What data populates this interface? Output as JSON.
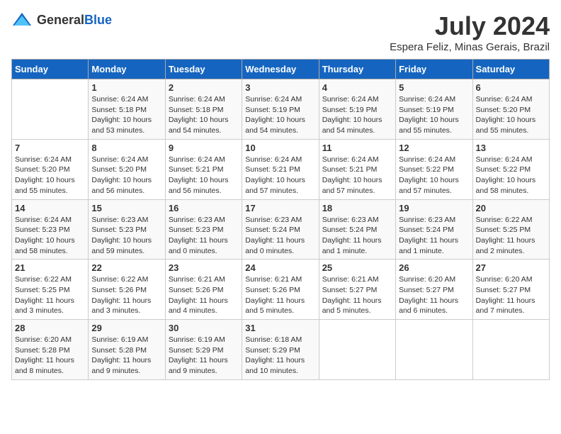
{
  "logo": {
    "general": "General",
    "blue": "Blue"
  },
  "title": "July 2024",
  "subtitle": "Espera Feliz, Minas Gerais, Brazil",
  "calendar": {
    "headers": [
      "Sunday",
      "Monday",
      "Tuesday",
      "Wednesday",
      "Thursday",
      "Friday",
      "Saturday"
    ],
    "weeks": [
      [
        {
          "day": "",
          "info": ""
        },
        {
          "day": "1",
          "info": "Sunrise: 6:24 AM\nSunset: 5:18 PM\nDaylight: 10 hours\nand 53 minutes."
        },
        {
          "day": "2",
          "info": "Sunrise: 6:24 AM\nSunset: 5:18 PM\nDaylight: 10 hours\nand 54 minutes."
        },
        {
          "day": "3",
          "info": "Sunrise: 6:24 AM\nSunset: 5:19 PM\nDaylight: 10 hours\nand 54 minutes."
        },
        {
          "day": "4",
          "info": "Sunrise: 6:24 AM\nSunset: 5:19 PM\nDaylight: 10 hours\nand 54 minutes."
        },
        {
          "day": "5",
          "info": "Sunrise: 6:24 AM\nSunset: 5:19 PM\nDaylight: 10 hours\nand 55 minutes."
        },
        {
          "day": "6",
          "info": "Sunrise: 6:24 AM\nSunset: 5:20 PM\nDaylight: 10 hours\nand 55 minutes."
        }
      ],
      [
        {
          "day": "7",
          "info": "Sunrise: 6:24 AM\nSunset: 5:20 PM\nDaylight: 10 hours\nand 55 minutes."
        },
        {
          "day": "8",
          "info": "Sunrise: 6:24 AM\nSunset: 5:20 PM\nDaylight: 10 hours\nand 56 minutes."
        },
        {
          "day": "9",
          "info": "Sunrise: 6:24 AM\nSunset: 5:21 PM\nDaylight: 10 hours\nand 56 minutes."
        },
        {
          "day": "10",
          "info": "Sunrise: 6:24 AM\nSunset: 5:21 PM\nDaylight: 10 hours\nand 57 minutes."
        },
        {
          "day": "11",
          "info": "Sunrise: 6:24 AM\nSunset: 5:21 PM\nDaylight: 10 hours\nand 57 minutes."
        },
        {
          "day": "12",
          "info": "Sunrise: 6:24 AM\nSunset: 5:22 PM\nDaylight: 10 hours\nand 57 minutes."
        },
        {
          "day": "13",
          "info": "Sunrise: 6:24 AM\nSunset: 5:22 PM\nDaylight: 10 hours\nand 58 minutes."
        }
      ],
      [
        {
          "day": "14",
          "info": "Sunrise: 6:24 AM\nSunset: 5:23 PM\nDaylight: 10 hours\nand 58 minutes."
        },
        {
          "day": "15",
          "info": "Sunrise: 6:23 AM\nSunset: 5:23 PM\nDaylight: 10 hours\nand 59 minutes."
        },
        {
          "day": "16",
          "info": "Sunrise: 6:23 AM\nSunset: 5:23 PM\nDaylight: 11 hours\nand 0 minutes."
        },
        {
          "day": "17",
          "info": "Sunrise: 6:23 AM\nSunset: 5:24 PM\nDaylight: 11 hours\nand 0 minutes."
        },
        {
          "day": "18",
          "info": "Sunrise: 6:23 AM\nSunset: 5:24 PM\nDaylight: 11 hours\nand 1 minute."
        },
        {
          "day": "19",
          "info": "Sunrise: 6:23 AM\nSunset: 5:24 PM\nDaylight: 11 hours\nand 1 minute."
        },
        {
          "day": "20",
          "info": "Sunrise: 6:22 AM\nSunset: 5:25 PM\nDaylight: 11 hours\nand 2 minutes."
        }
      ],
      [
        {
          "day": "21",
          "info": "Sunrise: 6:22 AM\nSunset: 5:25 PM\nDaylight: 11 hours\nand 3 minutes."
        },
        {
          "day": "22",
          "info": "Sunrise: 6:22 AM\nSunset: 5:26 PM\nDaylight: 11 hours\nand 3 minutes."
        },
        {
          "day": "23",
          "info": "Sunrise: 6:21 AM\nSunset: 5:26 PM\nDaylight: 11 hours\nand 4 minutes."
        },
        {
          "day": "24",
          "info": "Sunrise: 6:21 AM\nSunset: 5:26 PM\nDaylight: 11 hours\nand 5 minutes."
        },
        {
          "day": "25",
          "info": "Sunrise: 6:21 AM\nSunset: 5:27 PM\nDaylight: 11 hours\nand 5 minutes."
        },
        {
          "day": "26",
          "info": "Sunrise: 6:20 AM\nSunset: 5:27 PM\nDaylight: 11 hours\nand 6 minutes."
        },
        {
          "day": "27",
          "info": "Sunrise: 6:20 AM\nSunset: 5:27 PM\nDaylight: 11 hours\nand 7 minutes."
        }
      ],
      [
        {
          "day": "28",
          "info": "Sunrise: 6:20 AM\nSunset: 5:28 PM\nDaylight: 11 hours\nand 8 minutes."
        },
        {
          "day": "29",
          "info": "Sunrise: 6:19 AM\nSunset: 5:28 PM\nDaylight: 11 hours\nand 9 minutes."
        },
        {
          "day": "30",
          "info": "Sunrise: 6:19 AM\nSunset: 5:29 PM\nDaylight: 11 hours\nand 9 minutes."
        },
        {
          "day": "31",
          "info": "Sunrise: 6:18 AM\nSunset: 5:29 PM\nDaylight: 11 hours\nand 10 minutes."
        },
        {
          "day": "",
          "info": ""
        },
        {
          "day": "",
          "info": ""
        },
        {
          "day": "",
          "info": ""
        }
      ]
    ]
  }
}
